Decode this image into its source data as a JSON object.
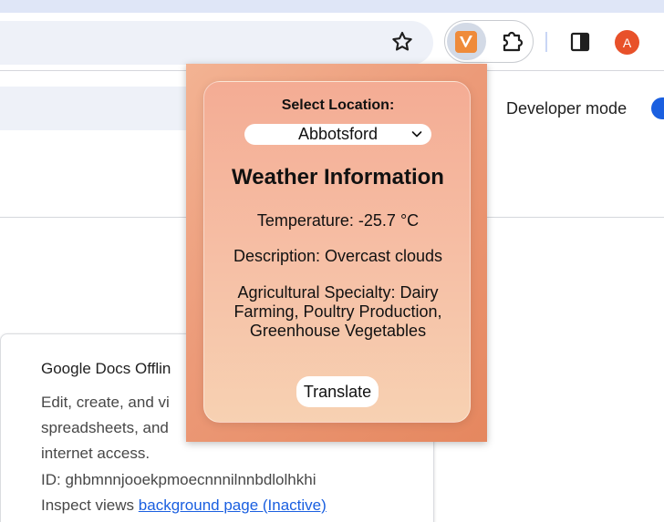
{
  "browser": {
    "avatar_letter": "A",
    "colors": {
      "accent": "#1a5fe0",
      "avatar": "#e8512a",
      "extension_icon": "#ef8b3a"
    },
    "icons": [
      "star-icon",
      "weather-extension-icon",
      "puzzle-icon",
      "side-panel-icon"
    ]
  },
  "extensions_page": {
    "developer_mode_label": "Developer mode",
    "developer_mode_on": true,
    "card": {
      "name": "Google Docs Offlin",
      "description_lines": [
        "Edit, create, and vi",
        "spreadsheets, and",
        "internet access."
      ],
      "id_text": "ID: ghbmnnjooekpmoecnnnilnnbdlolhkhi",
      "inspect_label": "Inspect views",
      "inspect_link": "background page (Inactive)"
    }
  },
  "popup": {
    "select_label": "Select Location:",
    "selected_location": "Abbotsford",
    "title": "Weather Information",
    "temperature": "Temperature: -25.7 °C",
    "description": "Description: Overcast clouds",
    "agri_lines": [
      "Agricultural Specialty: Dairy",
      "Farming, Poultry Production,",
      "Greenhouse Vegetables"
    ],
    "translate_label": "Translate",
    "colors": {
      "gradient_start": "#f3b393",
      "gradient_end": "#e5875f"
    }
  }
}
